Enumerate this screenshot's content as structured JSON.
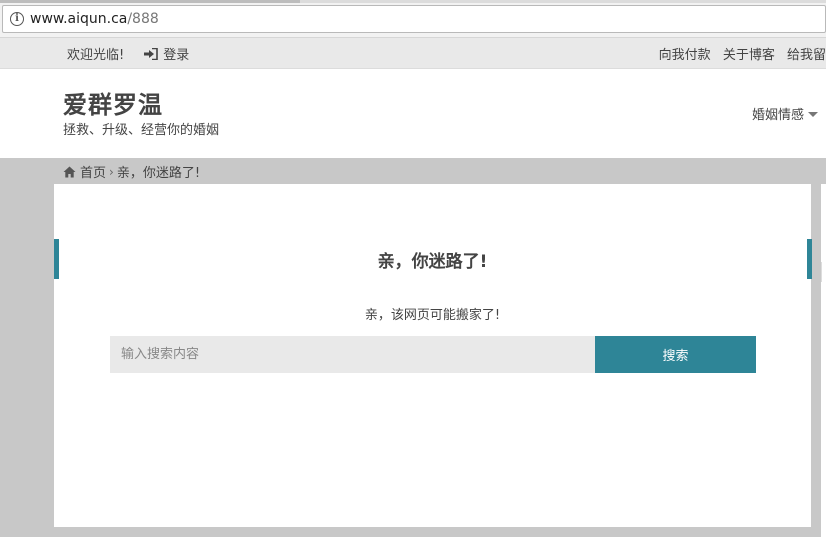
{
  "browser": {
    "url_host": "www.aiqun.ca",
    "url_path": "/888"
  },
  "topbar": {
    "welcome": "欢迎光临!",
    "login": "登录",
    "links": [
      "向我付款",
      "关于博客",
      "给我留"
    ]
  },
  "header": {
    "site_title": "爱群罗温",
    "tagline": "拯救、升级、经营你的婚姻",
    "nav_item": "婚姻情感"
  },
  "breadcrumb": {
    "home": "首页",
    "current": "亲，你迷路了!"
  },
  "main": {
    "heading": "亲，你迷路了!",
    "message": "亲，该网页可能搬家了!",
    "search_placeholder": "输入搜索内容",
    "search_button": "搜索"
  },
  "colors": {
    "accent": "#2e8597",
    "page_bg": "#c8c8c8",
    "topbar_bg": "#e9e9e9"
  }
}
